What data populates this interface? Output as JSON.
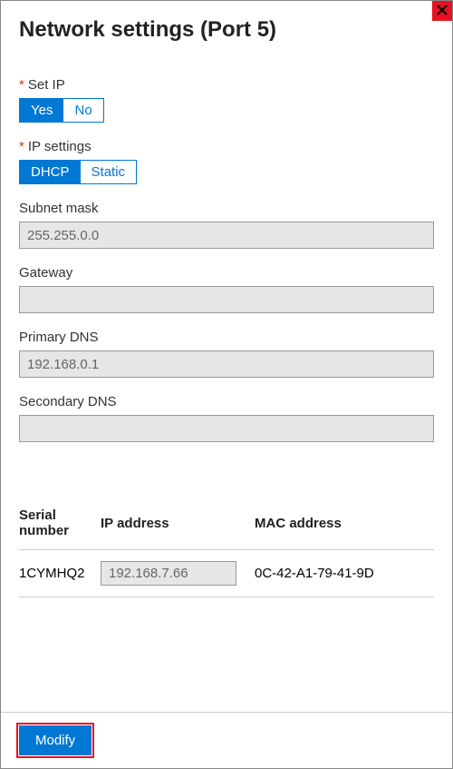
{
  "title": "Network settings (Port 5)",
  "fields": {
    "set_ip": {
      "label": "Set IP",
      "required": true,
      "yes": "Yes",
      "no": "No",
      "selected": "Yes"
    },
    "ip_settings": {
      "label": "IP settings",
      "required": true,
      "dhcp": "DHCP",
      "static": "Static",
      "selected": "DHCP"
    },
    "subnet_mask": {
      "label": "Subnet mask",
      "value": "255.255.0.0"
    },
    "gateway": {
      "label": "Gateway",
      "value": ""
    },
    "primary_dns": {
      "label": "Primary DNS",
      "value": "192.168.0.1"
    },
    "secondary_dns": {
      "label": "Secondary DNS",
      "value": ""
    }
  },
  "table": {
    "headers": {
      "serial": "Serial number",
      "ip": "IP address",
      "mac": "MAC address"
    },
    "rows": [
      {
        "serial": "1CYMHQ2",
        "ip": "192.168.7.66",
        "mac": "0C-42-A1-79-41-9D"
      }
    ]
  },
  "footer": {
    "modify": "Modify"
  }
}
